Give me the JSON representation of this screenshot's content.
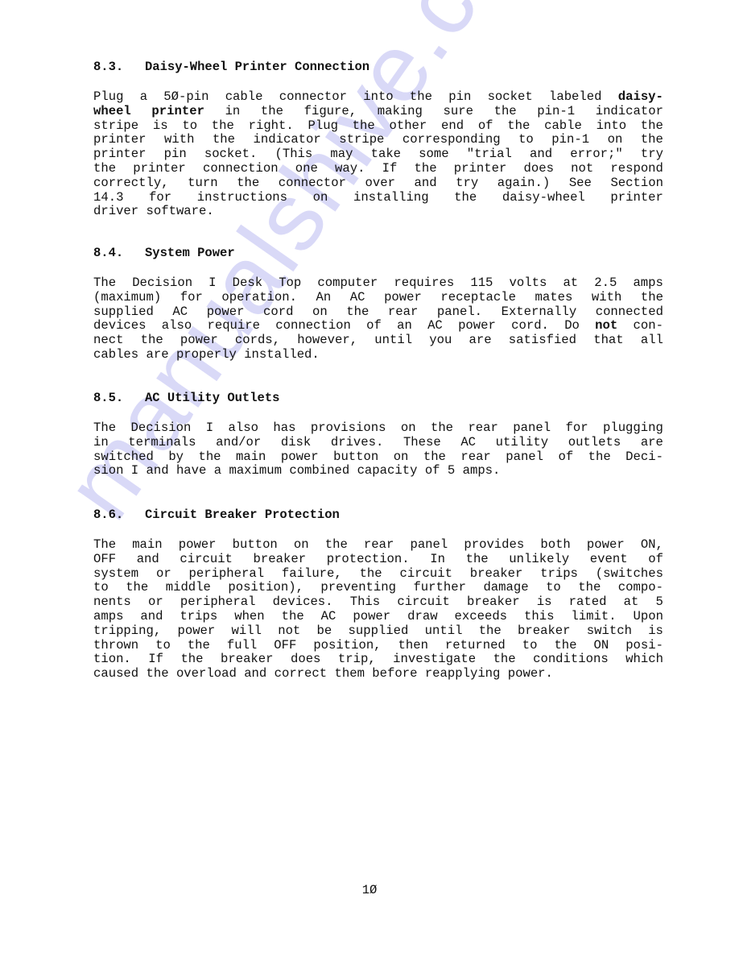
{
  "watermark": "manualshive.com",
  "sections": [
    {
      "number": "8.3.",
      "title": "Daisy-Wheel Printer Connection",
      "lines": [
        "Plug a 5Ø-pin cable connector into the pin socket labeled **daisy-**",
        "**wheel printer** in the figure, making sure the pin-1 indicator",
        "stripe is to the right. Plug the other end of the cable into the",
        "printer with the indicator stripe corresponding to pin-1 on the",
        "printer pin socket. (This may take some \"trial and error;\" try",
        "the printer connection one way. If the printer does not respond",
        "correctly, turn the connector over and try again.) See Section",
        "14.3 for instructions on installing the daisy-wheel printer",
        "driver software."
      ]
    },
    {
      "number": "8.4.",
      "title": "System Power",
      "lines": [
        "The Decision I Desk Top computer requires 115 volts at 2.5 amps",
        "(maximum) for operation. An AC power receptacle mates with the",
        "supplied AC power cord on the rear panel. Externally connected",
        "devices also require connection of an AC power cord. Do **not** con-",
        "nect the power cords, however, until you are satisfied that all",
        "cables are properly installed."
      ]
    },
    {
      "number": "8.5.",
      "title": "AC Utility Outlets",
      "lines": [
        "The Decision I also has provisions on the rear panel for plugging",
        "in terminals and/or disk drives. These AC utility outlets are",
        "switched by the main power button on the rear panel of the Deci-",
        "sion I and have a maximum combined capacity of 5 amps."
      ]
    },
    {
      "number": "8.6.",
      "title": "Circuit Breaker Protection",
      "lines": [
        "The main power button on the rear panel provides both power ON,",
        "OFF and circuit breaker protection. In the unlikely event of",
        "system or peripheral failure, the circuit breaker trips (switches",
        "to the middle position), preventing further damage to the compo-",
        "nents or peripheral devices. This circuit breaker is rated at 5",
        "amps and trips when the AC power draw exceeds this limit. Upon",
        "tripping, power will not be supplied until the breaker switch is",
        "thrown to the full OFF position, then returned to the ON posi-",
        "tion. If the breaker does trip, investigate the conditions which",
        "caused the overload and correct them before reapplying power."
      ]
    }
  ],
  "page_number": "1Ø"
}
